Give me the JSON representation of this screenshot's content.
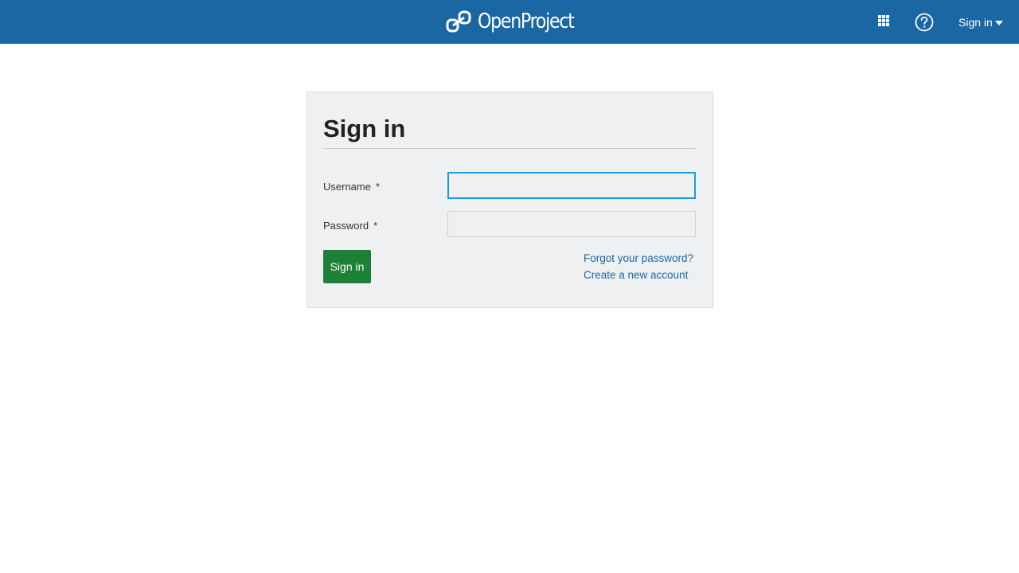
{
  "header": {
    "brand": "OpenProject",
    "brand_color": "#1a67a3",
    "icons": {
      "logo": "openproject-logo-icon",
      "modules": "grid-icon",
      "help": "question-circle-icon",
      "menu_caret": "caret-down-icon"
    },
    "signin_menu_label": "Sign in"
  },
  "login": {
    "title": "Sign in",
    "username_label": "Username",
    "password_label": "Password",
    "required_marker": "*",
    "username_value": "",
    "password_value": "",
    "submit_label": "Sign in",
    "submit_color": "#1c8036",
    "forgot_link": "Forgot your password?",
    "create_link": "Create a new account"
  }
}
